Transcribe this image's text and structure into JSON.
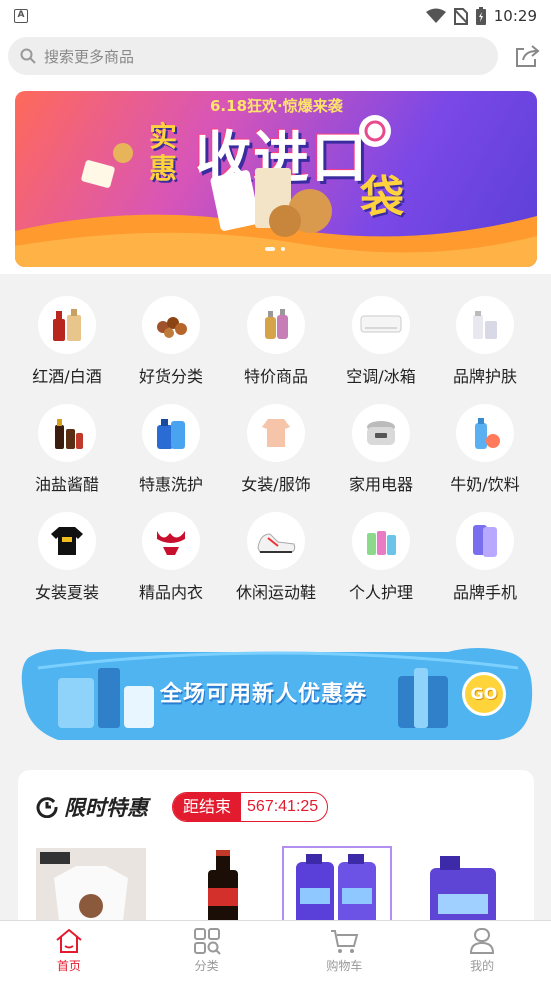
{
  "status": {
    "time": "10:29"
  },
  "search": {
    "placeholder": "搜索更多商品"
  },
  "banner": {
    "subtitle": "6.18狂欢·惊爆来袭",
    "left_text": "实惠",
    "title": "收进口",
    "bag_text": "袋"
  },
  "categories": [
    {
      "label": "红酒/白酒",
      "icon": "liquor-icon"
    },
    {
      "label": "好货分类",
      "icon": "nuts-icon"
    },
    {
      "label": "特价商品",
      "icon": "cosmetics-icon"
    },
    {
      "label": "空调/冰箱",
      "icon": "air-conditioner-icon"
    },
    {
      "label": "品牌护肤",
      "icon": "skincare-icon"
    },
    {
      "label": "油盐酱醋",
      "icon": "condiments-icon"
    },
    {
      "label": "特惠洗护",
      "icon": "detergent-icon"
    },
    {
      "label": "女装/服饰",
      "icon": "dress-icon"
    },
    {
      "label": "家用电器",
      "icon": "rice-cooker-icon"
    },
    {
      "label": "牛奶/饮料",
      "icon": "milk-icon"
    },
    {
      "label": "女装夏装",
      "icon": "tshirt-icon"
    },
    {
      "label": "精品内衣",
      "icon": "lingerie-icon"
    },
    {
      "label": "休闲运动鞋",
      "icon": "sneaker-icon"
    },
    {
      "label": "个人护理",
      "icon": "personal-care-icon"
    },
    {
      "label": "品牌手机",
      "icon": "phone-icon"
    }
  ],
  "promo": {
    "text": "全场可用新人优惠券",
    "go": "GO"
  },
  "flash": {
    "title": "限时特惠",
    "countdown_label": "距结束",
    "countdown_time": "567:41:25"
  },
  "nav": [
    {
      "label": "首页",
      "icon": "home-icon",
      "active": true
    },
    {
      "label": "分类",
      "icon": "grid-icon",
      "active": false
    },
    {
      "label": "购物车",
      "icon": "cart-icon",
      "active": false
    },
    {
      "label": "我的",
      "icon": "user-icon",
      "active": false
    }
  ],
  "colors": {
    "accent": "#e31b2e",
    "banner_purple": "#7b48e6",
    "promo_blue": "#4fb4f0"
  }
}
